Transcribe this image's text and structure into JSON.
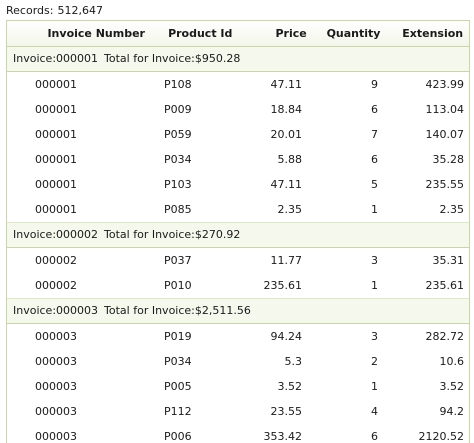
{
  "records_label": "Records:",
  "records_count": "512,647",
  "columns": {
    "invoice_number": "Invoice Number",
    "product_id": "Product Id",
    "price": "Price",
    "quantity": "Quantity",
    "extension": "Extension"
  },
  "groups": [
    {
      "label": "Invoice:000001",
      "total_label": "Total for Invoice:$950.28",
      "rows": [
        {
          "invoice": "000001",
          "product": "P108",
          "price": "47.11",
          "qty": "9",
          "ext": "423.99"
        },
        {
          "invoice": "000001",
          "product": "P009",
          "price": "18.84",
          "qty": "6",
          "ext": "113.04"
        },
        {
          "invoice": "000001",
          "product": "P059",
          "price": "20.01",
          "qty": "7",
          "ext": "140.07"
        },
        {
          "invoice": "000001",
          "product": "P034",
          "price": "5.88",
          "qty": "6",
          "ext": "35.28"
        },
        {
          "invoice": "000001",
          "product": "P103",
          "price": "47.11",
          "qty": "5",
          "ext": "235.55"
        },
        {
          "invoice": "000001",
          "product": "P085",
          "price": "2.35",
          "qty": "1",
          "ext": "2.35"
        }
      ]
    },
    {
      "label": "Invoice:000002",
      "total_label": "Total for Invoice:$270.92",
      "rows": [
        {
          "invoice": "000002",
          "product": "P037",
          "price": "11.77",
          "qty": "3",
          "ext": "35.31"
        },
        {
          "invoice": "000002",
          "product": "P010",
          "price": "235.61",
          "qty": "1",
          "ext": "235.61"
        }
      ]
    },
    {
      "label": "Invoice:000003",
      "total_label": "Total for Invoice:$2,511.56",
      "rows": [
        {
          "invoice": "000003",
          "product": "P019",
          "price": "94.24",
          "qty": "3",
          "ext": "282.72"
        },
        {
          "invoice": "000003",
          "product": "P034",
          "price": "5.3",
          "qty": "2",
          "ext": "10.6"
        },
        {
          "invoice": "000003",
          "product": "P005",
          "price": "3.52",
          "qty": "1",
          "ext": "3.52"
        },
        {
          "invoice": "000003",
          "product": "P112",
          "price": "23.55",
          "qty": "4",
          "ext": "94.2"
        },
        {
          "invoice": "000003",
          "product": "P006",
          "price": "353.42",
          "qty": "6",
          "ext": "2120.52"
        }
      ]
    }
  ]
}
